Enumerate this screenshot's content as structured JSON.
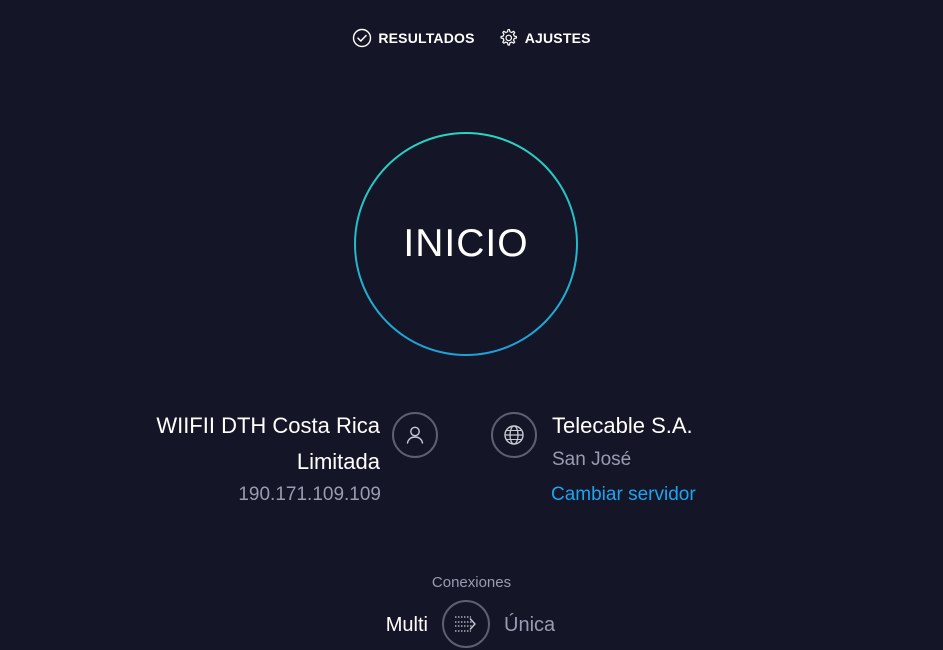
{
  "nav": {
    "results_label": "RESULTADOS",
    "settings_label": "AJUSTES",
    "results_icon": "check-circle-icon",
    "settings_icon": "gear-icon"
  },
  "start": {
    "label": "INICIO"
  },
  "isp": {
    "name": "WIIFII DTH Costa Rica Limitada",
    "ip": "190.171.109.109",
    "icon": "user-icon"
  },
  "server": {
    "name": "Telecable S.A.",
    "city": "San José",
    "change_label": "Cambiar servidor",
    "icon": "globe-icon"
  },
  "connections": {
    "label": "Conexiones",
    "multi_label": "Multi",
    "single_label": "Única",
    "toggle_icon": "connections-toggle-icon",
    "selected": "Multi"
  },
  "colors": {
    "background": "#141526",
    "ring_top": "#2ad4c0",
    "ring_bottom": "#1f9fd8",
    "link": "#1fa3f0",
    "muted_text": "#9a9bb0"
  }
}
